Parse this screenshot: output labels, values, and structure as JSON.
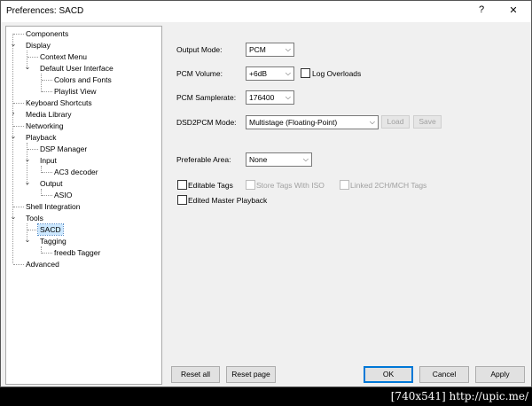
{
  "window": {
    "title": "Preferences: SACD",
    "help_glyph": "?",
    "close_glyph": "✕"
  },
  "tree": {
    "items": [
      {
        "label": "Components"
      },
      {
        "label": "Display"
      },
      {
        "label": "Context Menu"
      },
      {
        "label": "Default User Interface"
      },
      {
        "label": "Colors and Fonts"
      },
      {
        "label": "Playlist View"
      },
      {
        "label": "Keyboard Shortcuts"
      },
      {
        "label": "Media Library"
      },
      {
        "label": "Networking"
      },
      {
        "label": "Playback"
      },
      {
        "label": "DSP Manager"
      },
      {
        "label": "Input"
      },
      {
        "label": "AC3 decoder"
      },
      {
        "label": "Output"
      },
      {
        "label": "ASIO"
      },
      {
        "label": "Shell Integration"
      },
      {
        "label": "Tools"
      },
      {
        "label": "SACD"
      },
      {
        "label": "Tagging"
      },
      {
        "label": "freedb Tagger"
      },
      {
        "label": "Advanced"
      }
    ],
    "selected": "SACD"
  },
  "panel": {
    "output_mode": {
      "label": "Output Mode:",
      "value": "PCM"
    },
    "pcm_volume": {
      "label": "PCM Volume:",
      "value": "+6dB"
    },
    "log_overloads": {
      "label": "Log Overloads",
      "checked": false
    },
    "pcm_samplerate": {
      "label": "PCM Samplerate:",
      "value": "176400"
    },
    "dsd2pcm_mode": {
      "label": "DSD2PCM Mode:",
      "value": "Multistage (Floating-Point)"
    },
    "load_label": "Load",
    "save_label": "Save",
    "preferable_area": {
      "label": "Preferable Area:",
      "value": "None"
    },
    "editable_tags": {
      "label": "Editable Tags",
      "checked": false
    },
    "store_tags_iso": {
      "label": "Store Tags With ISO",
      "checked": false,
      "enabled": false
    },
    "linked_2ch": {
      "label": "Linked 2CH/MCH Tags",
      "checked": false,
      "enabled": false
    },
    "edited_master": {
      "label": "Edited Master Playback",
      "checked": false
    }
  },
  "buttons": {
    "reset_all": "Reset all",
    "reset_page": "Reset page",
    "ok": "OK",
    "cancel": "Cancel",
    "apply": "Apply"
  },
  "watermark": "[740x541] http://upic.me/"
}
